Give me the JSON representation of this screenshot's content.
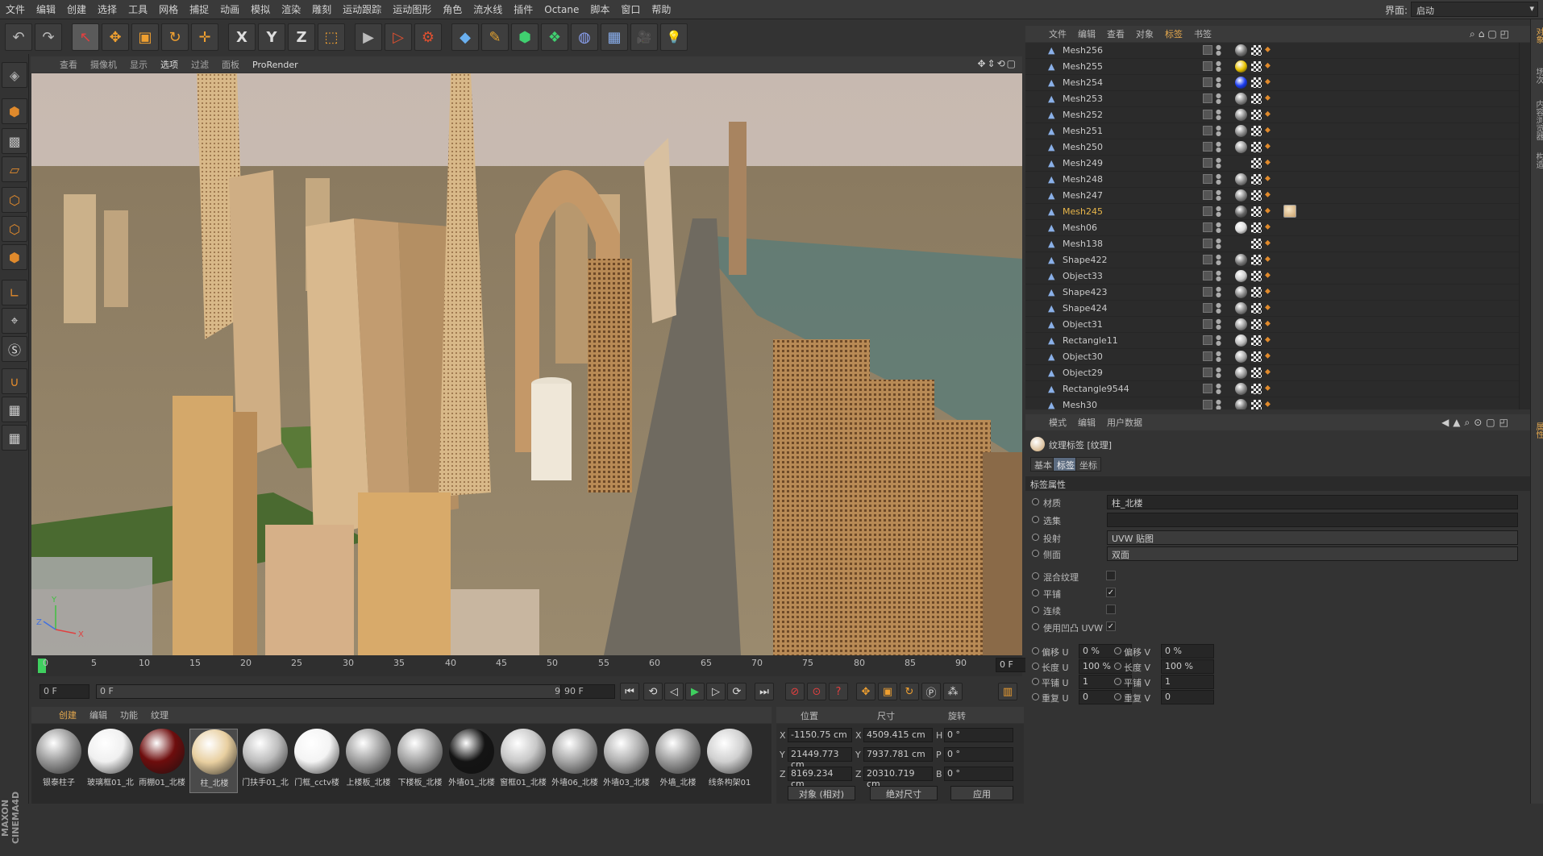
{
  "menu": [
    "文件",
    "编辑",
    "创建",
    "选择",
    "工具",
    "网格",
    "捕捉",
    "动画",
    "模拟",
    "渲染",
    "雕刻",
    "运动跟踪",
    "运动图形",
    "角色",
    "流水线",
    "插件",
    "Octane",
    "脚本",
    "窗口",
    "帮助"
  ],
  "layout": {
    "label": "界面:",
    "value": "启动"
  },
  "toolbar": {
    "undo": "↶",
    "redo": "↷",
    "select": "↖",
    "move": "✥",
    "scale": "▣",
    "rotate": "↻",
    "place": "✛",
    "x": "X",
    "y": "Y",
    "z": "Z",
    "coord": "⬚",
    "render_view": "▶",
    "render_pic": "▷",
    "render_settings": "⚙",
    "cube": "◆",
    "pen": "✎",
    "nurbs": "⬢",
    "array": "❖",
    "deform": "◍",
    "floor": "▦",
    "camera": "🎥",
    "light": "💡"
  },
  "viewport": {
    "menu": [
      "查看",
      "摄像机",
      "显示",
      "选项",
      "过滤",
      "面板",
      "ProRender"
    ],
    "active_menu": "选项",
    "icons": "✥⇕⟲▢",
    "axis": {
      "y": "Y",
      "z": "Z",
      "x": "X"
    }
  },
  "timeline": {
    "ticks": [
      "0",
      "5",
      "10",
      "15",
      "20",
      "25",
      "30",
      "35",
      "40",
      "45",
      "50",
      "55",
      "60",
      "65",
      "70",
      "75",
      "80",
      "85",
      "90"
    ],
    "current_frame": "0 F"
  },
  "transport": {
    "start": "0 F",
    "range_start": "0 F",
    "range_end": "90 F",
    "end": "90 F"
  },
  "materials": {
    "menu": [
      "创建",
      "编辑",
      "功能",
      "纹理"
    ],
    "items": [
      {
        "label": "银泰柱子",
        "color": "#9a9a9a"
      },
      {
        "label": "玻璃框01_北",
        "color": "#f0f0f0"
      },
      {
        "label": "雨棚01_北楼",
        "color": "#6e0d0d"
      },
      {
        "label": "柱_北楼",
        "color": "#e8cfa0",
        "selected": true
      },
      {
        "label": "门扶手01_北",
        "color": "#bdbdbd"
      },
      {
        "label": "门框_cctv楼",
        "color": "#f4f4f4"
      },
      {
        "label": "上楼板_北楼",
        "color": "#a0a0a0"
      },
      {
        "label": "下楼板_北楼",
        "color": "#a4a4a4"
      },
      {
        "label": "外墙01_北楼",
        "color": "#141414"
      },
      {
        "label": "窗框01_北楼",
        "color": "#c8c8c8"
      },
      {
        "label": "外墙06_北楼",
        "color": "#a6a6a6"
      },
      {
        "label": "外墙03_北楼",
        "color": "#b0b0b0"
      },
      {
        "label": "外墙_北楼",
        "color": "#9c9c9c"
      },
      {
        "label": "线条构架01",
        "color": "#d0d0d0"
      }
    ]
  },
  "coords": {
    "headers": [
      "位置",
      "尺寸",
      "旋转"
    ],
    "rows": [
      {
        "axis": "X",
        "pos": "-1150.75 cm",
        "size_axis": "X",
        "size": "4509.415 cm",
        "rot_axis": "H",
        "rot": "0 °"
      },
      {
        "axis": "Y",
        "pos": "21449.773 cm",
        "size_axis": "Y",
        "size": "7937.781 cm",
        "rot_axis": "P",
        "rot": "0 °"
      },
      {
        "axis": "Z",
        "pos": "8169.234 cm",
        "size_axis": "Z",
        "size": "20310.719 cm",
        "rot_axis": "B",
        "rot": "0 °"
      }
    ],
    "mode": "对象 (相对)",
    "size_mode": "绝对尺寸",
    "apply": "应用"
  },
  "objects": {
    "menu": [
      "文件",
      "编辑",
      "查看",
      "对象",
      "标签",
      "书签"
    ],
    "active_menu": "标签",
    "rows": [
      {
        "name": "Mesh256",
        "ball": "#777"
      },
      {
        "name": "Mesh255",
        "ball": "#e8c200"
      },
      {
        "name": "Mesh254",
        "ball": "#1a3cf0"
      },
      {
        "name": "Mesh253",
        "ball": "#888"
      },
      {
        "name": "Mesh252",
        "ball": "#888"
      },
      {
        "name": "Mesh251",
        "ball": "#888"
      },
      {
        "name": "Mesh250",
        "ball": "#999"
      },
      {
        "name": "Mesh249",
        "ball": ""
      },
      {
        "name": "Mesh248",
        "ball": "#888"
      },
      {
        "name": "Mesh247",
        "ball": "#888"
      },
      {
        "name": "Mesh245",
        "ball": "#666",
        "selected": true
      },
      {
        "name": "Mesh06",
        "ball": "#ddd"
      },
      {
        "name": "Mesh138",
        "ball": ""
      },
      {
        "name": "Shape422",
        "ball": "#777"
      },
      {
        "name": "Object33",
        "ball": "#ccc"
      },
      {
        "name": "Shape423",
        "ball": "#888"
      },
      {
        "name": "Shape424",
        "ball": "#888"
      },
      {
        "name": "Object31",
        "ball": "#999"
      },
      {
        "name": "Rectangle11",
        "ball": "#bbb"
      },
      {
        "name": "Object30",
        "ball": "#aaa"
      },
      {
        "name": "Object29",
        "ball": "#999"
      },
      {
        "name": "Rectangle9544",
        "ball": "#888"
      },
      {
        "name": "Mesh30",
        "ball": "#777"
      }
    ]
  },
  "attributes": {
    "menu": [
      "模式",
      "编辑",
      "用户数据"
    ],
    "title": "纹理标签 [纹理]",
    "tabs": [
      "基本",
      "标签",
      "坐标"
    ],
    "active_tab": "标签",
    "section": "标签属性",
    "material_label": "材质",
    "material_value": "柱_北楼",
    "selection_label": "选集",
    "selection_value": "",
    "projection_label": "投射",
    "projection_value": "UVW 贴图",
    "side_label": "侧面",
    "side_value": "双面",
    "mix_label": "混合纹理",
    "mix_checked": "",
    "tile_label": "平铺",
    "tile_checked": "✓",
    "seamless_label": "连续",
    "seamless_checked": "",
    "bump_label": "使用凹凸 UVW",
    "bump_checked": "✓",
    "pairs": [
      {
        "l1": "偏移 U",
        "v1": "0 %",
        "l2": "偏移 V",
        "v2": "0 %"
      },
      {
        "l1": "长度 U",
        "v1": "100 %",
        "l2": "长度 V",
        "v2": "100 %"
      },
      {
        "l1": "平铺 U",
        "v1": "1",
        "l2": "平铺 V",
        "v2": "1"
      },
      {
        "l1": "重复 U",
        "v1": "0",
        "l2": "重复 V",
        "v2": "0"
      }
    ]
  },
  "right_strip": [
    "对象",
    "场次",
    "内容浏览器",
    "构造",
    "属性"
  ]
}
